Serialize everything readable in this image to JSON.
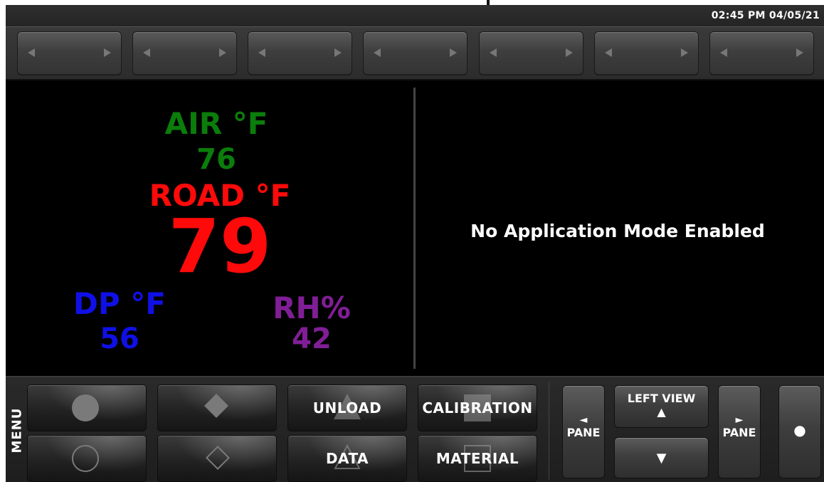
{
  "status": {
    "clock": "02:45 PM 04/05/21"
  },
  "soft_keys": [
    {
      "label": ""
    },
    {
      "label": ""
    },
    {
      "label": ""
    },
    {
      "label": ""
    },
    {
      "label": ""
    },
    {
      "label": ""
    },
    {
      "label": ""
    }
  ],
  "readings": {
    "air": {
      "label": "AIR °F",
      "value": "76",
      "color": "#0b7d0b"
    },
    "road": {
      "label": "ROAD °F",
      "value": "79",
      "color": "#ff0a0a"
    },
    "dp": {
      "label": "DP °F",
      "value": "56",
      "color": "#1010e6"
    },
    "rh": {
      "label": "RH%",
      "value": "42",
      "color": "#801e96"
    }
  },
  "mode_message": "No Application Mode Enabled",
  "menu": {
    "label": "MENU",
    "buttons": [
      {
        "label": "",
        "icon": "filled-circle-icon"
      },
      {
        "label": "",
        "icon": "filled-diamond-icon"
      },
      {
        "label": "UNLOAD",
        "icon": "triangle-icon"
      },
      {
        "label": "CALIBRATION",
        "icon": "square-icon"
      },
      {
        "label": "",
        "icon": "outline-circle-icon"
      },
      {
        "label": "",
        "icon": "outline-diamond-icon"
      },
      {
        "label": "DATA",
        "icon": "outline-triangle-icon"
      },
      {
        "label": "MATERIAL",
        "icon": "outline-square-icon"
      }
    ]
  },
  "nav": {
    "pane_left": {
      "arrow": "◄",
      "label": "PANE"
    },
    "left_view": {
      "label": "LEFT VIEW",
      "arrow": "▲"
    },
    "down": {
      "arrow": "▼"
    },
    "pane_right": {
      "arrow": "►",
      "label": "PANE"
    },
    "dot": {
      "symbol": "●"
    }
  }
}
